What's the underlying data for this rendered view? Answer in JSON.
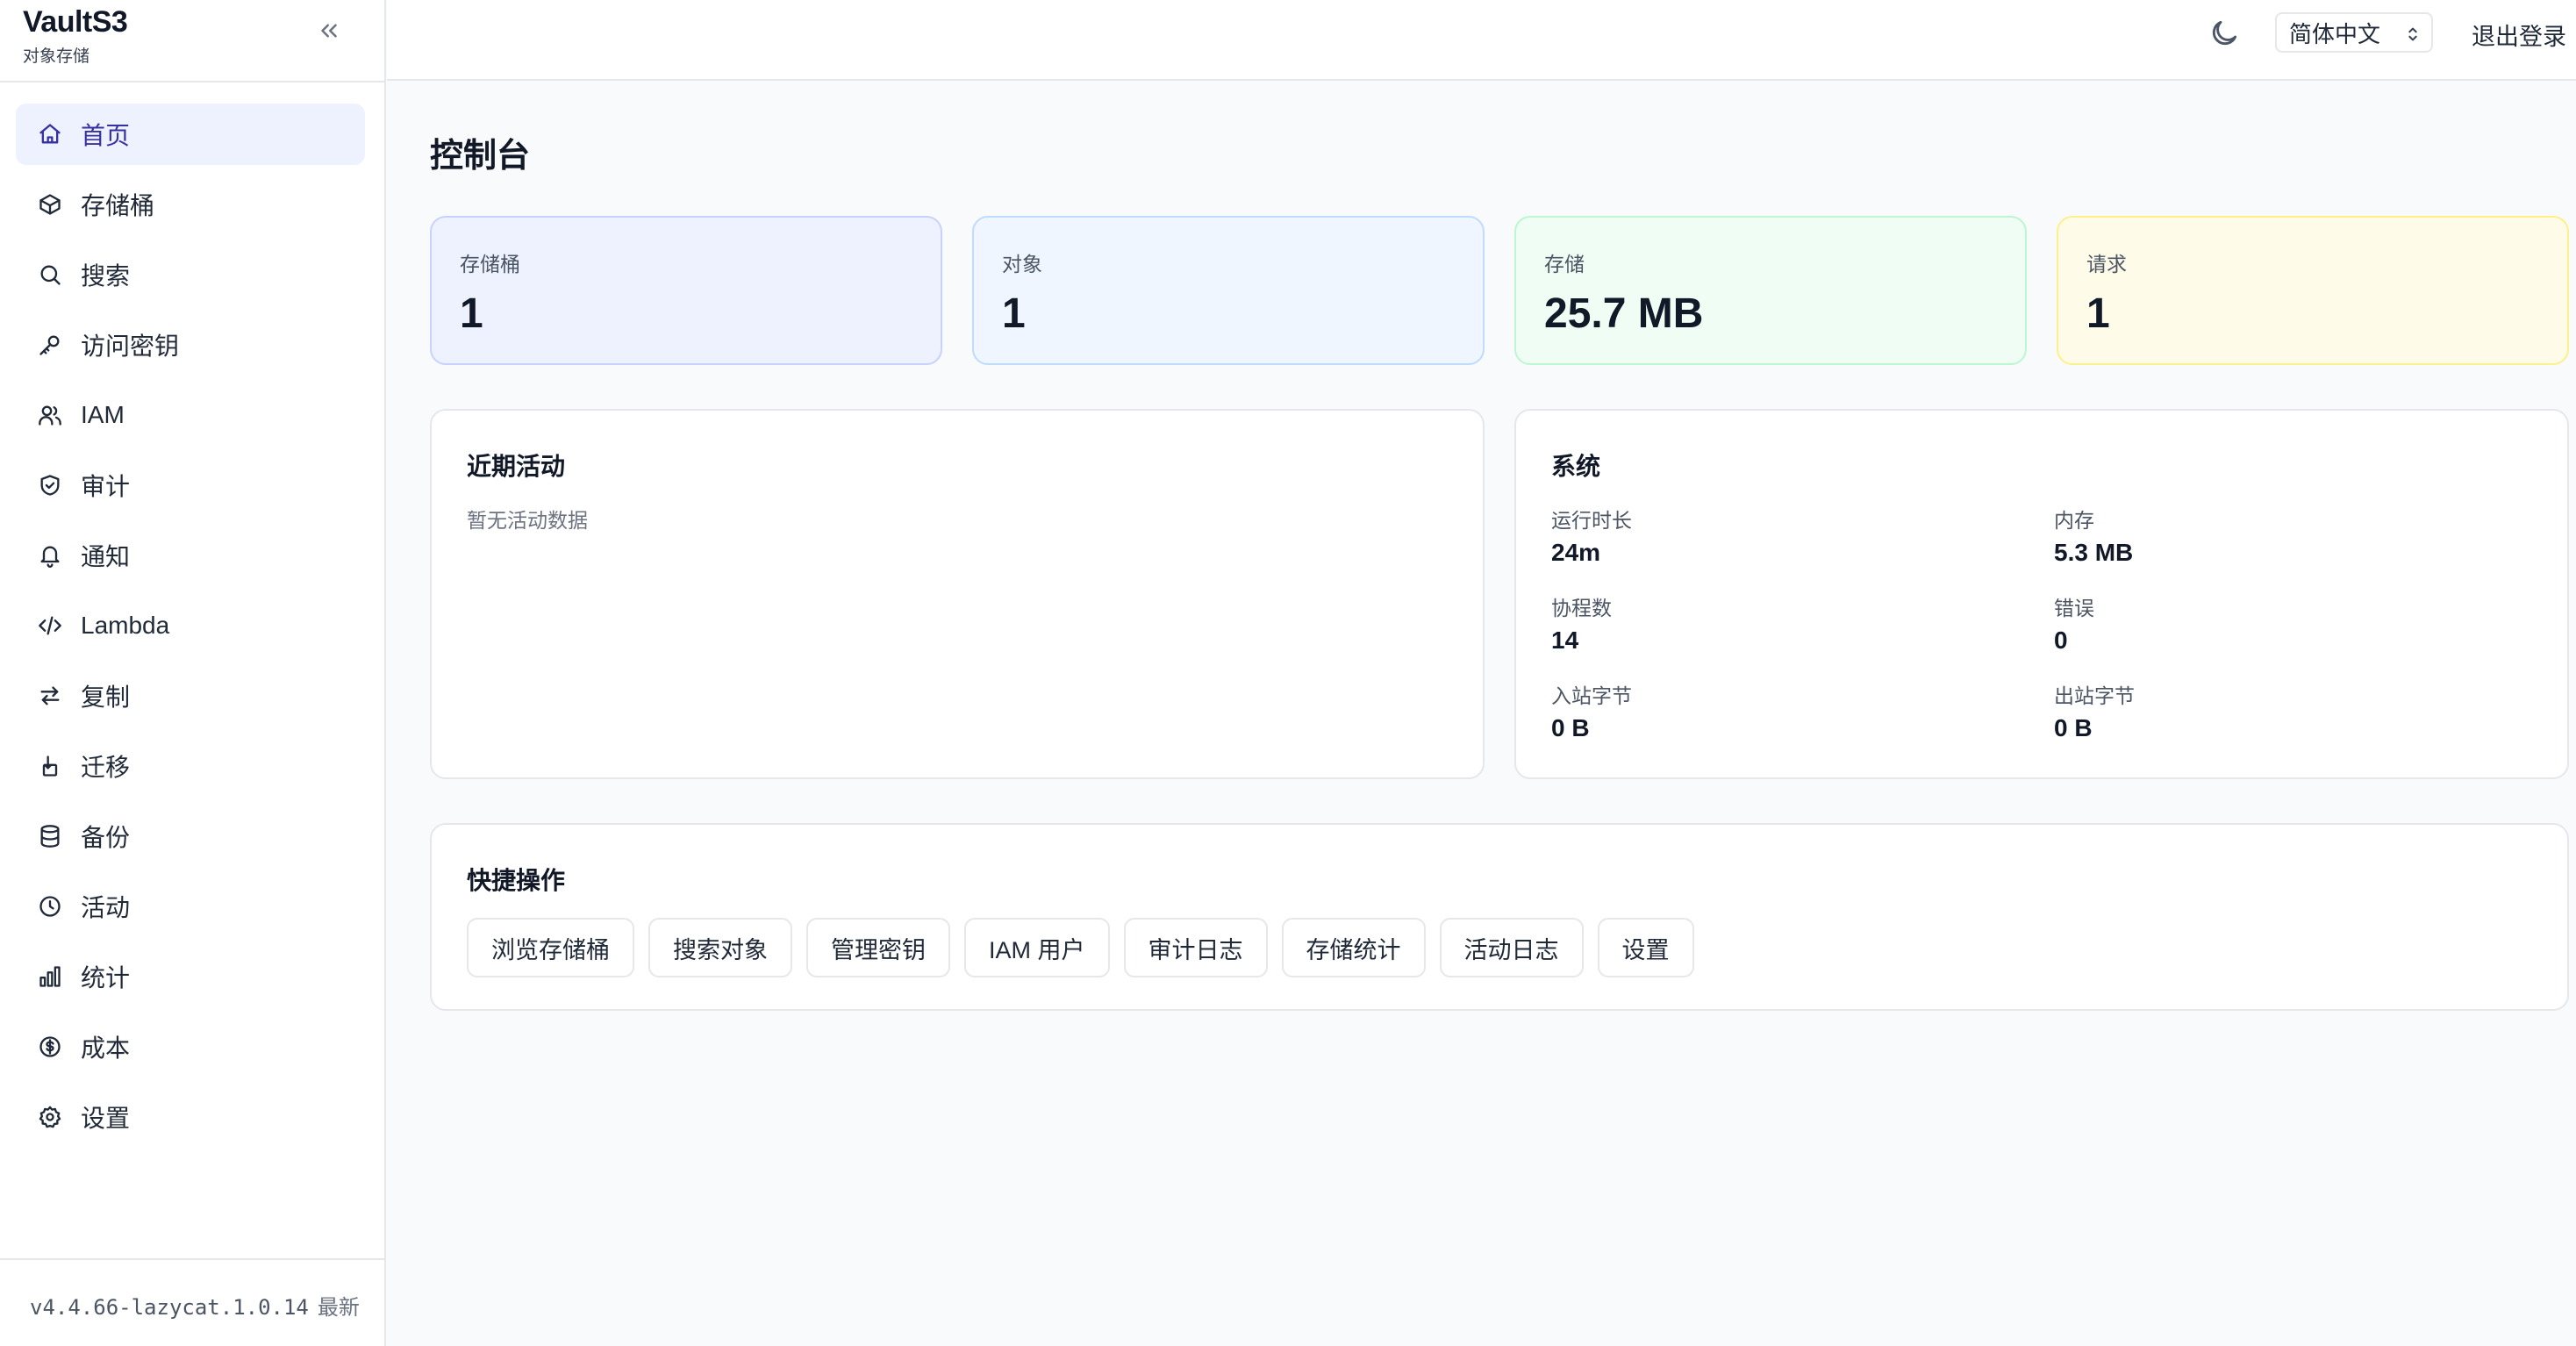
{
  "brand": {
    "name": "VaultS3",
    "subtitle": "对象存储"
  },
  "sidebar": {
    "items": [
      {
        "label": "首页",
        "icon": "home-icon",
        "active": true
      },
      {
        "label": "存储桶",
        "icon": "box-icon"
      },
      {
        "label": "搜索",
        "icon": "search-icon"
      },
      {
        "label": "访问密钥",
        "icon": "key-icon"
      },
      {
        "label": "IAM",
        "icon": "users-icon"
      },
      {
        "label": "审计",
        "icon": "shield-check-icon"
      },
      {
        "label": "通知",
        "icon": "bell-icon"
      },
      {
        "label": "Lambda",
        "icon": "code-icon"
      },
      {
        "label": "复制",
        "icon": "arrows-swap-icon"
      },
      {
        "label": "迁移",
        "icon": "migrate-icon"
      },
      {
        "label": "备份",
        "icon": "database-icon"
      },
      {
        "label": "活动",
        "icon": "clock-icon"
      },
      {
        "label": "统计",
        "icon": "bar-chart-icon"
      },
      {
        "label": "成本",
        "icon": "dollar-circle-icon"
      },
      {
        "label": "设置",
        "icon": "gear-icon"
      }
    ],
    "version": "v4.4.66-lazycat.1.0.14",
    "version_status": "最新"
  },
  "topbar": {
    "language": "简体中文",
    "logout": "退出登录"
  },
  "main": {
    "title": "控制台",
    "stats": {
      "buckets": {
        "label": "存储桶",
        "value": "1"
      },
      "objects": {
        "label": "对象",
        "value": "1"
      },
      "storage": {
        "label": "存储",
        "value": "25.7 MB"
      },
      "requests": {
        "label": "请求",
        "value": "1"
      }
    },
    "activity": {
      "title": "近期活动",
      "empty": "暂无活动数据"
    },
    "system": {
      "title": "系统",
      "uptime": {
        "label": "运行时长",
        "value": "24m"
      },
      "memory": {
        "label": "内存",
        "value": "5.3 MB"
      },
      "goroutines": {
        "label": "协程数",
        "value": "14"
      },
      "errors": {
        "label": "错误",
        "value": "0"
      },
      "bytes_in": {
        "label": "入站字节",
        "value": "0 B"
      },
      "bytes_out": {
        "label": "出站字节",
        "value": "0 B"
      }
    },
    "quick": {
      "title": "快捷操作",
      "buttons": [
        "浏览存储桶",
        "搜索对象",
        "管理密钥",
        "IAM 用户",
        "审计日志",
        "存储统计",
        "活动日志",
        "设置"
      ]
    }
  },
  "colors": {
    "accent": "#3730a3",
    "active_bg": "#eef2ff",
    "buckets_bg": "#eef2ff",
    "objects_bg": "#eff6ff",
    "storage_bg": "#f0fdf4",
    "requests_bg": "#fefce8"
  }
}
